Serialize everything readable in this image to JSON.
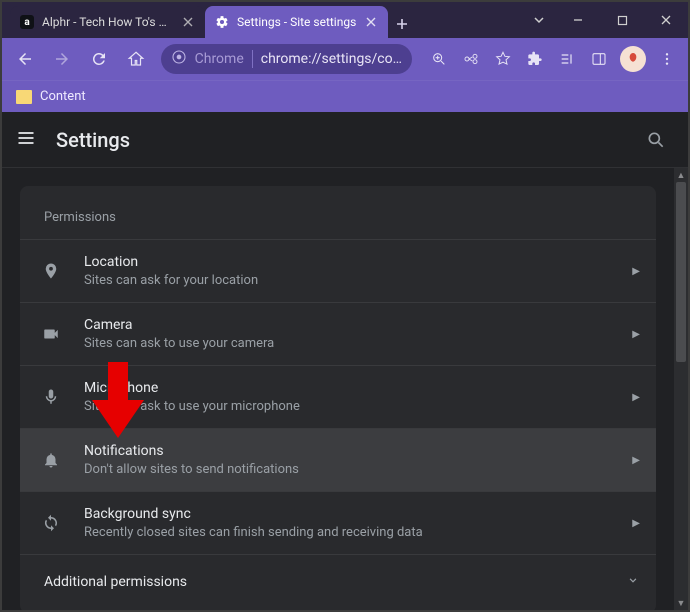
{
  "window": {
    "tabs": [
      {
        "title": "Alphr - Tech How To's & G",
        "active": false,
        "favicon": "alphr"
      },
      {
        "title": "Settings - Site settings",
        "active": true,
        "favicon": "gear"
      }
    ]
  },
  "toolbar": {
    "chrome_label": "Chrome",
    "url_display": "chrome://settings/co…",
    "bookmarks": [
      {
        "label": "Content"
      }
    ]
  },
  "settings": {
    "header_title": "Settings",
    "section_label": "Permissions",
    "rows": [
      {
        "icon": "location",
        "title": "Location",
        "desc": "Sites can ask for your location",
        "highlight": false
      },
      {
        "icon": "camera",
        "title": "Camera",
        "desc": "Sites can ask to use your camera",
        "highlight": false
      },
      {
        "icon": "mic",
        "title": "Microphone",
        "desc": "Sites can ask to use your microphone",
        "highlight": false
      },
      {
        "icon": "bell",
        "title": "Notifications",
        "desc": "Don't allow sites to send notifications",
        "highlight": true
      },
      {
        "icon": "sync",
        "title": "Background sync",
        "desc": "Recently closed sites can finish sending and receiving data",
        "highlight": false
      }
    ],
    "additional_label": "Additional permissions"
  }
}
